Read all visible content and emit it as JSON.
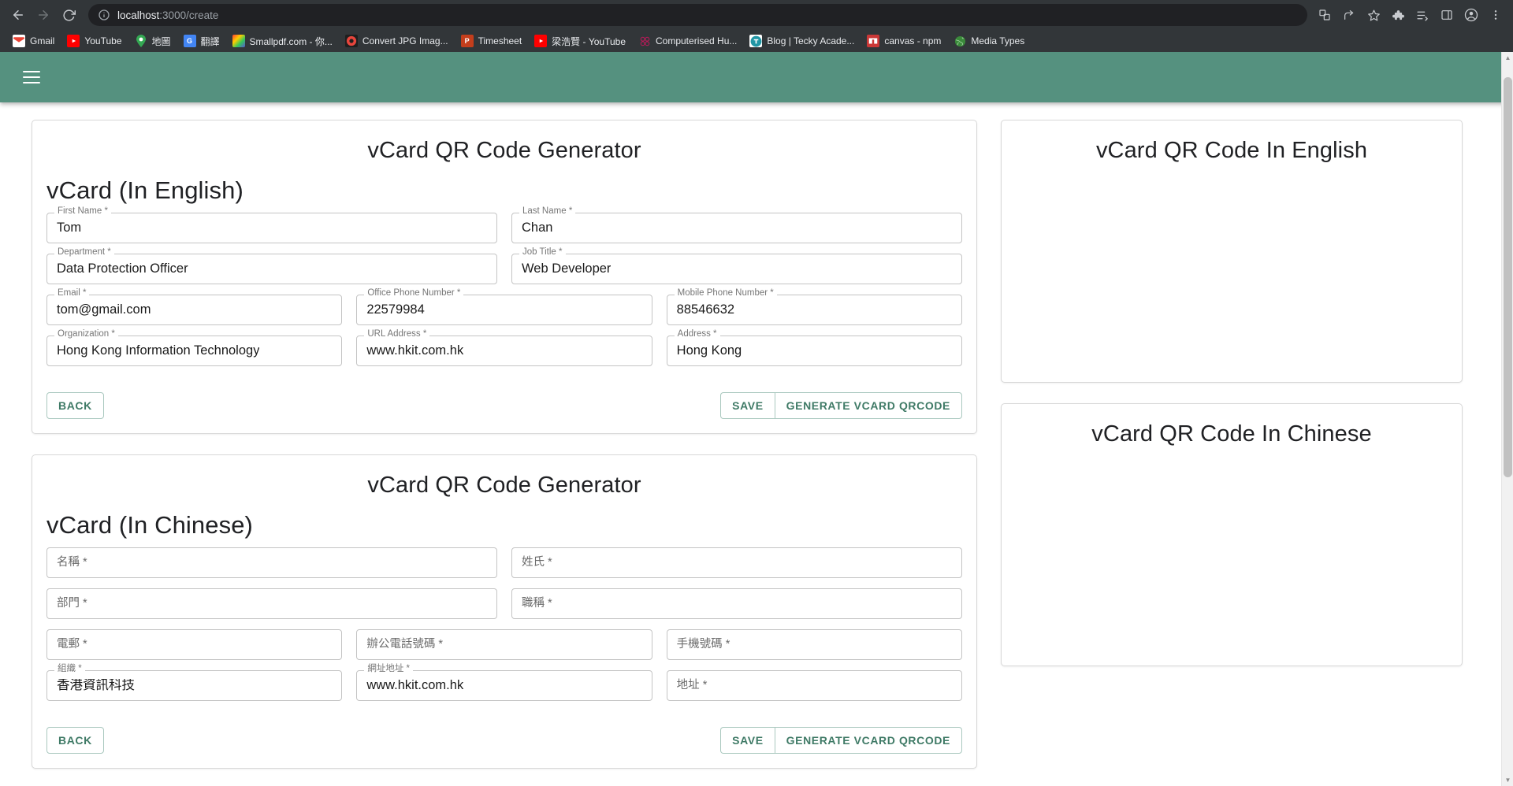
{
  "browser": {
    "nav": {
      "back": "back-arrow",
      "forward": "forward-arrow",
      "reload": "reload-icon"
    },
    "omnibox": {
      "site_info_icon": "info-circle-icon",
      "url_host": "localhost",
      "url_path": ":3000/create",
      "full_url": "localhost:3000/create"
    },
    "toolbar_icons": [
      {
        "name": "translate-icon",
        "glyph": "文"
      },
      {
        "name": "share-icon",
        "glyph": "⤴"
      },
      {
        "name": "bookmark-star-icon",
        "glyph": "☆"
      },
      {
        "name": "extensions-puzzle-icon",
        "glyph": "⚙"
      },
      {
        "name": "reading-list-icon",
        "glyph": "≡"
      },
      {
        "name": "side-panel-icon",
        "glyph": "◫"
      },
      {
        "name": "profile-avatar-icon",
        "glyph": "●"
      },
      {
        "name": "chrome-menu-icon",
        "glyph": "⋮"
      }
    ],
    "bookmarks": [
      {
        "label": "Gmail",
        "icon": "gmail-icon"
      },
      {
        "label": "YouTube",
        "icon": "youtube-icon"
      },
      {
        "label": "地圖",
        "icon": "google-maps-icon"
      },
      {
        "label": "翻譯",
        "icon": "google-translate-icon"
      },
      {
        "label": "Smallpdf.com - 你...",
        "icon": "smallpdf-icon"
      },
      {
        "label": "Convert JPG Imag...",
        "icon": "convert-jpg-icon"
      },
      {
        "label": "Timesheet",
        "icon": "powerpoint-icon"
      },
      {
        "label": "梁浩賢 - YouTube",
        "icon": "youtube-icon"
      },
      {
        "label": "Computerised Hu...",
        "icon": "computerised-icon"
      },
      {
        "label": "Blog | Tecky Acade...",
        "icon": "tecky-icon"
      },
      {
        "label": "canvas - npm",
        "icon": "npm-icon"
      },
      {
        "label": "Media Types",
        "icon": "globe-icon"
      }
    ]
  },
  "app": {
    "appbar": {
      "menu_icon": "hamburger-menu-icon",
      "color": "#55917f"
    },
    "accent_color": "#3f7a66",
    "english_form": {
      "card_title": "vCard QR Code Generator",
      "section_heading": "vCard (In English)",
      "rows": [
        [
          {
            "label": "First Name",
            "required": "*",
            "value": "Tom",
            "name": "first-name"
          },
          {
            "label": "Last Name",
            "required": "*",
            "value": "Chan",
            "name": "last-name"
          }
        ],
        [
          {
            "label": "Department",
            "required": "*",
            "value": "Data Protection Officer",
            "name": "department"
          },
          {
            "label": "Job Title",
            "required": "*",
            "value": "Web Developer",
            "name": "job-title"
          }
        ],
        [
          {
            "label": "Email",
            "required": "*",
            "value": "tom@gmail.com",
            "name": "email"
          },
          {
            "label": "Office Phone Number",
            "required": "*",
            "value": "22579984",
            "name": "office-phone"
          },
          {
            "label": "Mobile Phone Number",
            "required": "*",
            "value": "88546632",
            "name": "mobile-phone"
          }
        ],
        [
          {
            "label": "Organization",
            "required": "*",
            "value": "Hong Kong Information Technology",
            "name": "organization"
          },
          {
            "label": "URL Address",
            "required": "*",
            "value": "www.hkit.com.hk",
            "name": "url-address"
          },
          {
            "label": "Address",
            "required": "*",
            "value": "Hong Kong",
            "name": "address"
          }
        ]
      ],
      "buttons": {
        "back": "BACK",
        "save": "SAVE",
        "generate": "GENERATE VCARD QRCODE"
      }
    },
    "chinese_form": {
      "card_title": "vCard QR Code Generator",
      "section_heading": "vCard (In Chinese)",
      "rows": [
        [
          {
            "label": "名稱",
            "required": "*",
            "value": "",
            "name": "first-name-zh"
          },
          {
            "label": "姓氏",
            "required": "*",
            "value": "",
            "name": "last-name-zh"
          }
        ],
        [
          {
            "label": "部門",
            "required": "*",
            "value": "",
            "name": "department-zh"
          },
          {
            "label": "職稱",
            "required": "*",
            "value": "",
            "name": "job-title-zh"
          }
        ],
        [
          {
            "label": "電郵",
            "required": "*",
            "value": "",
            "name": "email-zh"
          },
          {
            "label": "辦公電話號碼",
            "required": "*",
            "value": "",
            "name": "office-phone-zh"
          },
          {
            "label": "手機號碼",
            "required": "*",
            "value": "",
            "name": "mobile-phone-zh"
          }
        ],
        [
          {
            "label": "組織",
            "required": "*",
            "value": "香港資訊科技",
            "name": "organization-zh"
          },
          {
            "label": "網址地址",
            "required": "*",
            "value": "www.hkit.com.hk",
            "name": "url-address-zh"
          },
          {
            "label": "地址",
            "required": "*",
            "value": "",
            "name": "address-zh"
          }
        ]
      ],
      "buttons": {
        "back": "BACK",
        "save": "SAVE",
        "generate": "GENERATE VCARD QRCODE"
      }
    },
    "qr_english": {
      "title": "vCard QR Code In English",
      "image": ""
    },
    "qr_chinese": {
      "title": "vCard QR Code In Chinese",
      "image": ""
    }
  }
}
